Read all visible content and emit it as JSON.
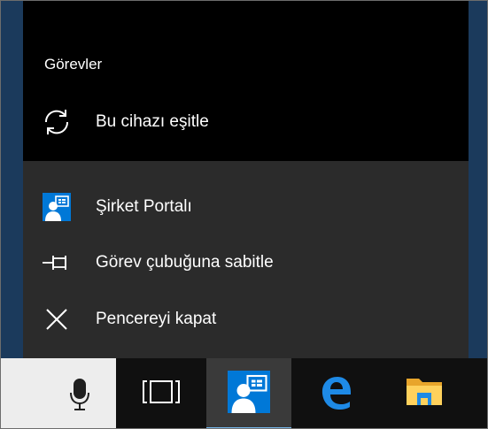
{
  "jumplist": {
    "tasks_heading": "Görevler",
    "sync_label": "Bu cihazı eşitle",
    "app_label": "Şirket Portalı",
    "pin_label": "Görev çubuğuna sabitle",
    "close_label": "Pencereyi kapat"
  },
  "taskbar": {
    "buttons": [
      "microphone-icon",
      "task-view-icon",
      "company-portal-icon",
      "edge-icon",
      "file-explorer-icon"
    ]
  },
  "colors": {
    "desktop": "#1b3a5c",
    "jumplist_bg": "#2b2b2b",
    "tasks_bg": "#000000",
    "taskbar_bg": "#101010",
    "active_indicator": "#76b9ed",
    "portal_blue": "#0078d7"
  }
}
